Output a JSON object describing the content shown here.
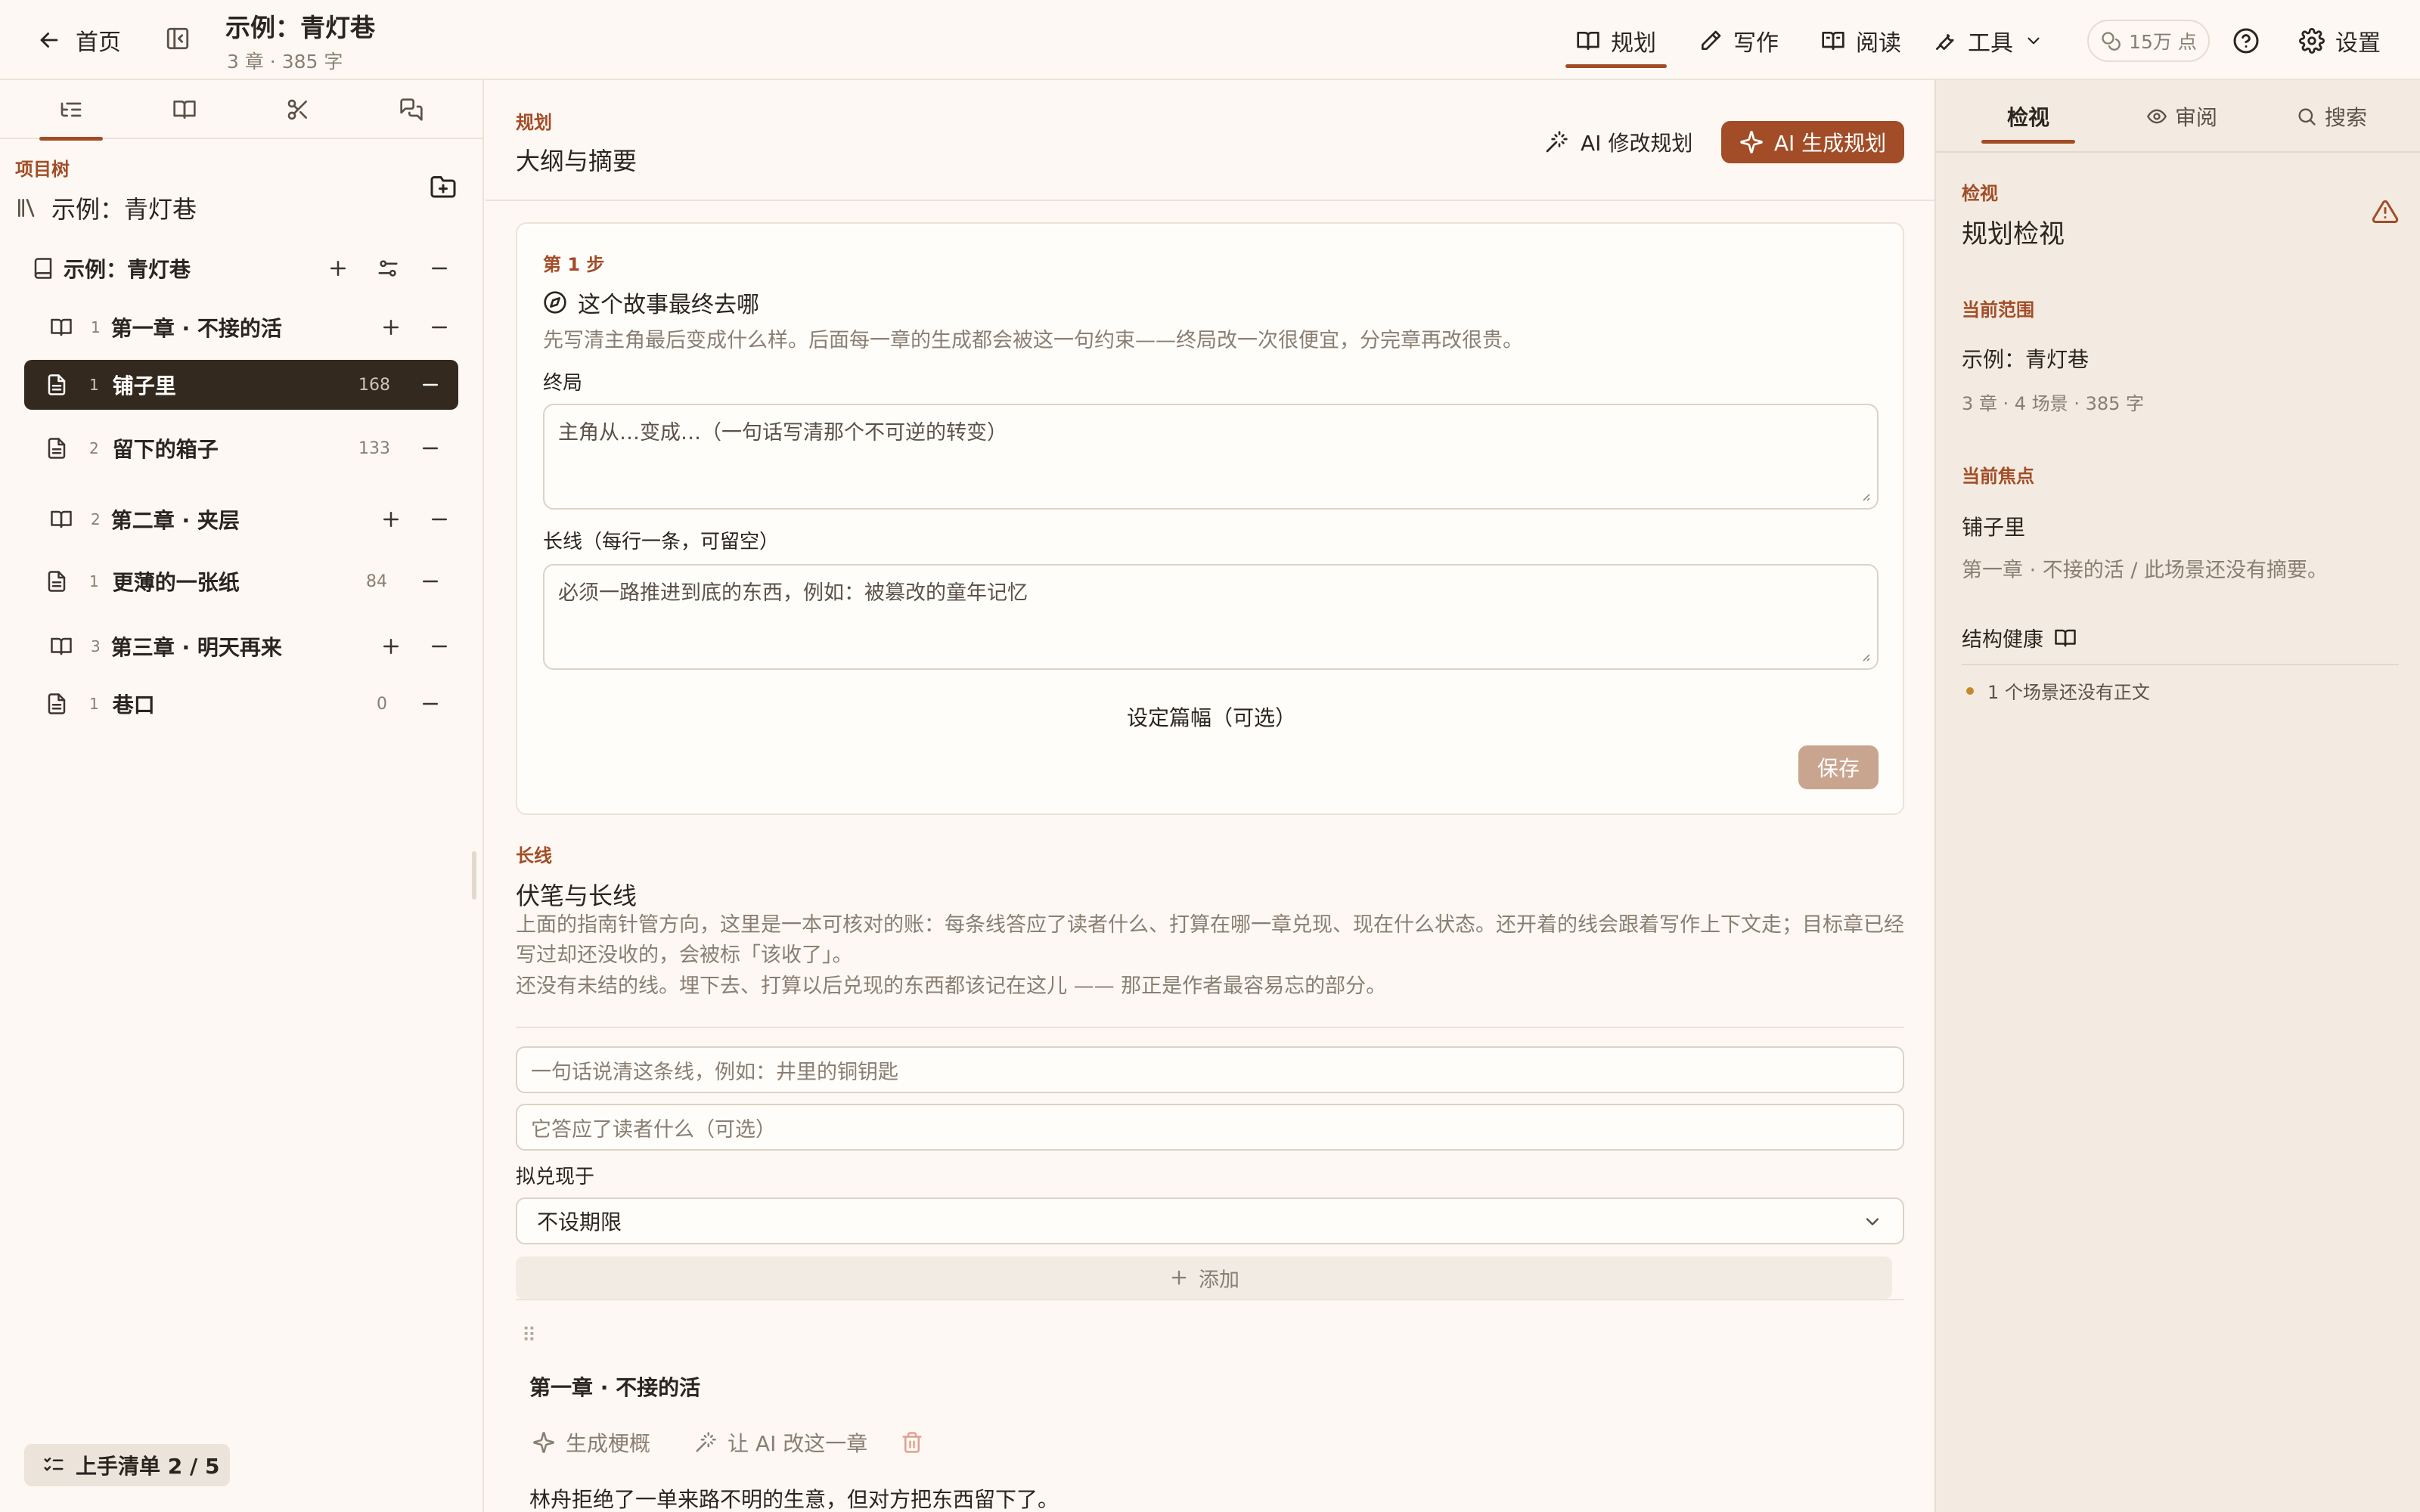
{
  "header": {
    "back_label": "首页",
    "project_title": "示例：青灯巷",
    "project_meta": "3 章 · 385 字",
    "modes": [
      {
        "label": "规划",
        "icon": "book-open-icon",
        "active": true
      },
      {
        "label": "写作",
        "icon": "pen-icon",
        "active": false
      },
      {
        "label": "阅读",
        "icon": "reader-icon",
        "active": false
      }
    ],
    "tools_label": "工具",
    "points_label": "15万 点",
    "settings_label": "设置"
  },
  "sidebar": {
    "tree_label": "项目树",
    "root_label": "示例：青灯巷",
    "book": {
      "label": "示例：青灯巷"
    },
    "chapters": [
      {
        "num": "1",
        "label": "第一章 · 不接的活",
        "scenes": [
          {
            "num": "1",
            "label": "铺子里",
            "count": "168",
            "selected": true
          },
          {
            "num": "2",
            "label": "留下的箱子",
            "count": "133",
            "selected": false
          }
        ]
      },
      {
        "num": "2",
        "label": "第二章 · 夹层",
        "scenes": [
          {
            "num": "1",
            "label": "更薄的一张纸",
            "count": "84",
            "selected": false
          }
        ]
      },
      {
        "num": "3",
        "label": "第三章 · 明天再来",
        "scenes": [
          {
            "num": "1",
            "label": "巷口",
            "count": "0",
            "selected": false
          }
        ]
      }
    ],
    "onboarding_label": "上手清单 2 / 5"
  },
  "main": {
    "kicker": "规划",
    "title": "大纲与摘要",
    "ai_modify_label": "AI 修改规划",
    "ai_generate_label": "AI 生成规划",
    "step": {
      "kicker": "第 1 步",
      "question": "这个故事最终去哪",
      "description": "先写清主角最后变成什么样。后面每一章的生成都会被这一句约束——终局改一次很便宜，分完章再改很贵。",
      "ending_label": "终局",
      "ending_placeholder": "主角从…变成…（一句话写清那个不可逆的转变）",
      "threads_label": "长线（每行一条，可留空）",
      "threads_placeholder": "必须一路推进到底的东西，例如：被篡改的童年记忆",
      "length_link": "设定篇幅（可选）",
      "save_label": "保存"
    },
    "lines": {
      "kicker": "长线",
      "title": "伏笔与长线",
      "description": "上面的指南针管方向，这里是一本可核对的账：每条线答应了读者什么、打算在哪一章兑现、现在什么状态。还开着的线会跟着写作上下文走；目标章已经写过却还没收的，会被标「该收了」。",
      "empty_note": "还没有未结的线。埋下去、打算以后兑现的东西都该记在这儿 —— 那正是作者最容易忘的部分。",
      "line_placeholder": "一句话说清这条线，例如：井里的铜钥匙",
      "promise_placeholder": "它答应了读者什么（可选）",
      "due_label": "拟兑现于",
      "due_value": "不设期限",
      "add_label": "添加"
    },
    "chapter_card": {
      "title": "第一章 · 不接的活",
      "generate_label": "生成梗概",
      "ai_edit_label": "让 AI 改这一章",
      "summary": "林舟拒绝了一单来路不明的生意，但对方把东西留下了。"
    }
  },
  "right_panel": {
    "tabs": [
      {
        "label": "检视",
        "active": true
      },
      {
        "label": "审阅",
        "active": false,
        "icon": "eye-icon"
      },
      {
        "label": "搜索",
        "active": false,
        "icon": "search-icon"
      }
    ],
    "kicker": "检视",
    "title": "规划检视",
    "scope_label": "当前范围",
    "scope_title": "示例：青灯巷",
    "scope_stats": "3 章 · 4 场景 · 385 字",
    "focus_label": "当前焦点",
    "focus_title": "铺子里",
    "focus_desc": "第一章 · 不接的活 / 此场景还没有摘要。",
    "health_label": "结构健康",
    "issues": [
      "1 个场景还没有正文"
    ]
  },
  "colors": {
    "accent": "#a24d27",
    "background": "#fdf8f3",
    "panel": "#f3ebe1",
    "selected_row": "#33291f",
    "warning_dot": "#c8872c"
  }
}
